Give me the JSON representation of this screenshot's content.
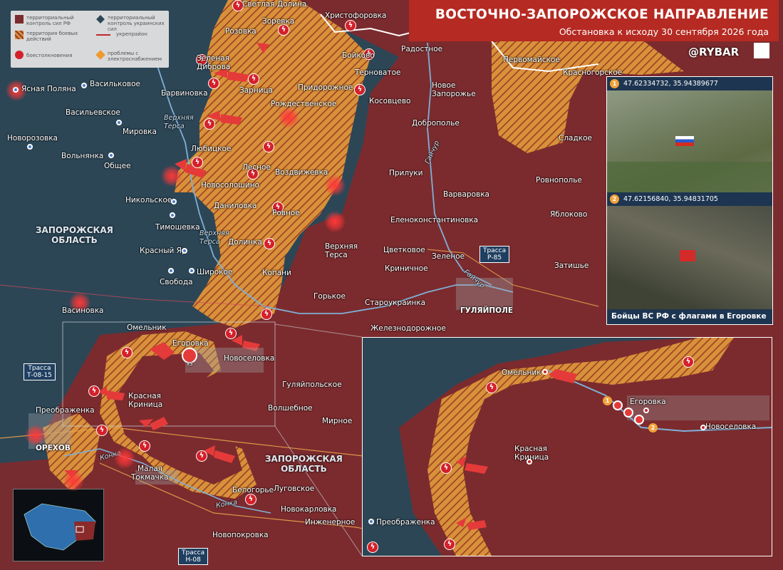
{
  "header": {
    "title": "ВОСТОЧНО-ЗАПОРОЖСКОЕ НАПРАВЛЕНИЕ",
    "subtitle": "Обстановка к исходу 30 сентября 2026 года",
    "brand": "@RYBAR",
    "colors": {
      "title_bg": "#b52a22",
      "ru_control": "#7a2a2c",
      "contested": "#d99a3a",
      "ua_control": "#2a4352"
    }
  },
  "legend": {
    "ru": "территориальный контроль сил РФ",
    "ua": "территориальный контроль украинских сил",
    "contested": "территория боевых действий",
    "ur": "укрепрайон",
    "clash": "боестолкновения",
    "ew": "проблемы с электроснабжением"
  },
  "towns": {
    "yasnaya_polyana": "Ясная Поляна",
    "vasilkovoe": "Васильковое",
    "vasilevskoe": "Васильевское",
    "mirovka": "Мировка",
    "novorozovka": "Новорозовка",
    "volnyanka": "Вольнянка",
    "obshchee": "Общее",
    "nikolskoe": "Никольское",
    "timoshevka": "Тимошевка",
    "krasny_yar": "Красный Яр",
    "svoboda": "Свобода",
    "shirokoe": "Широкое",
    "vasinovka": "Васиновка",
    "svetlaya_dolina": "Светлая Долина",
    "rozovka": "Розовка",
    "zorevka": "Зоревка",
    "khristoforovka": "Христофоровка",
    "zelenaya": "Зеленая",
    "dibrova": "Диброва",
    "barvinovka": "Барвиновка",
    "zarnitsa": "Зарница",
    "lyubitskoe": "Любицкое",
    "novosoloshino": "Новосолошино",
    "lesnoe": "Лесное",
    "danilovka": "Даниловка",
    "dolinka": "Долинка",
    "kopani": "Копани",
    "rovnoe": "Ровное",
    "rozhdestvenskoe": "Рождественское",
    "vozdvizhevka": "Воздвижевка",
    "boykovo": "Бойково",
    "ternovatoe": "Терноватое",
    "pridorozhnoe": "Придорожное",
    "kosovtsevo": "Косовцево",
    "radostnoe": "Радостное",
    "novoe": "Новое",
    "zaporozhe": "Запорожье",
    "dobropole": "Доброполье",
    "pervomayskoe": "Первомайское",
    "krasnogorskoe": "Красногорское",
    "sladkoe": "Сладкое",
    "pryluky": "Прилуки",
    "varvarovka": "Варваровка",
    "rovnopole": "Ровнополье",
    "yablokovo": "Яблоково",
    "elenokonstantinovka": "Еленоконстантиновка",
    "verkhnyaya": "Верхняя",
    "tersa": "Терса",
    "tsvetkovoe": "Цветковое",
    "zelenoe": "Зеленое",
    "krinichnoe": "Криничное",
    "zatishe": "Затишье",
    "gorkoe": "Горькое",
    "staroukrainka": "Староукраинка",
    "gulyaypole": "ГУЛЯЙПОЛЕ",
    "zheleznodorozhnoe": "Железнодорожное",
    "omelnik": "Омельник",
    "egorovka": "Егоровка",
    "novoselovka": "Новоселовка",
    "gulyaypolskoe": "Гуляйпольское",
    "krasnaya": "Красная",
    "krinitsa": "Криница",
    "volshebnoe": "Волшебное",
    "mirnoe": "Мирное",
    "preobrazhenka": "Преображенка",
    "orekhov": "ОРЕХОВ",
    "malaya": "Малая",
    "tokmachka": "Токмачка",
    "belogorye": "Белогорье",
    "lugovskoe": "Луговское",
    "novokarlovka": "Новокарловка",
    "inzhenernoe": "Инженерное",
    "novopokrovka": "Новопокровка"
  },
  "regions": {
    "zap_1a": "ЗАПОРОЖСКАЯ",
    "zap_1b": "ОБЛАСТЬ",
    "zap_2a": "ЗАПОРОЖСКАЯ",
    "zap_2b": "ОБЛАСТЬ"
  },
  "rivers": {
    "vt1a": "Верхняя",
    "vt1b": "Терса",
    "vt2a": "Верхняя",
    "vt2b": "Терса",
    "gaychur1": "Гайчур",
    "gaychur2": "Гайчур",
    "konka1": "Конка",
    "konka2": "Конка"
  },
  "roads": {
    "r85a": "Трасса",
    "r85b": "Р-85",
    "t0815a": "Трасса",
    "t0815b": "Т-08-15",
    "h08a": "Трасса",
    "h08b": "Н-08"
  },
  "photos": {
    "coord1": "47.62334732, 35.94389677",
    "coord2": "47.62156840, 35.94831705",
    "num1": "1",
    "num2": "2",
    "caption": "Бойцы ВС РФ с флагами в Егоровке"
  },
  "inset": {
    "omelnik": "Омельник",
    "egorovka": "Егоровка",
    "novoselovka": "Новоселовка",
    "krasnaya": "Красная",
    "krinitsa": "Криница",
    "preobrazhenka": "Преображенка",
    "num1": "1",
    "num2": "2"
  },
  "markers": {
    "x3": "x3"
  }
}
